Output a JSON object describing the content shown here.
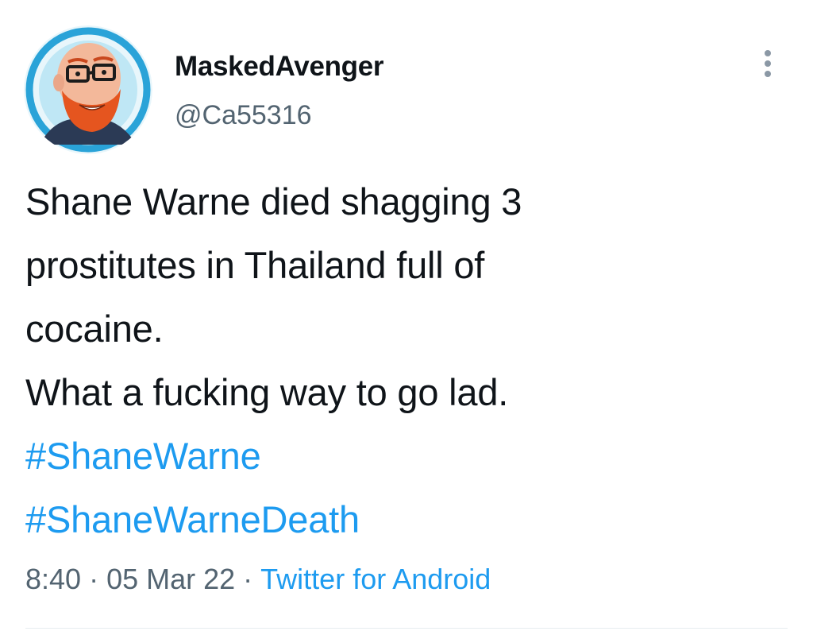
{
  "tweet": {
    "display_name": "MaskedAvenger",
    "handle": "@Ca55316",
    "text_lines": [
      "Shane Warne died shagging 3",
      "prostitutes in Thailand full of",
      "cocaine.",
      "What a fucking way to go lad."
    ],
    "hashtags": [
      "#ShaneWarne",
      "#ShaneWarneDeath"
    ],
    "time": "8:40",
    "date": "05 Mar 22",
    "separator": "·",
    "source": "Twitter for Android"
  },
  "icons": {
    "avatar": "cartoon-avatar-icon",
    "more": "more-options-icon"
  },
  "colors": {
    "link": "#1d9bf0",
    "secondary_text": "#536471",
    "primary_text": "#0f1419"
  }
}
